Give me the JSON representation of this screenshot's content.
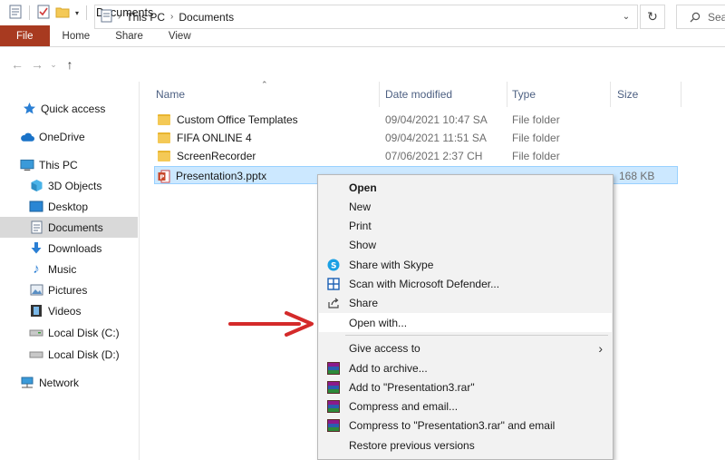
{
  "window": {
    "title": "Documents"
  },
  "ribbon": {
    "file": "File",
    "home": "Home",
    "share": "Share",
    "view": "View"
  },
  "address": {
    "crumbs": [
      "This PC",
      "Documents"
    ]
  },
  "search": {
    "placeholder": "Sea"
  },
  "nav": {
    "quick_access": "Quick access",
    "onedrive": "OneDrive",
    "this_pc": "This PC",
    "objects3d": "3D Objects",
    "desktop": "Desktop",
    "documents": "Documents",
    "downloads": "Downloads",
    "music": "Music",
    "pictures": "Pictures",
    "videos": "Videos",
    "local_c": "Local Disk (C:)",
    "local_d": "Local Disk (D:)",
    "network": "Network"
  },
  "columns": {
    "name": "Name",
    "date": "Date modified",
    "type": "Type",
    "size": "Size"
  },
  "files": [
    {
      "name": "Custom Office Templates",
      "date": "09/04/2021 10:47 SA",
      "type": "File folder",
      "size": ""
    },
    {
      "name": "FIFA ONLINE 4",
      "date": "09/04/2021 11:51 SA",
      "type": "File folder",
      "size": ""
    },
    {
      "name": "ScreenRecorder",
      "date": "07/06/2021 2:37 CH",
      "type": "File folder",
      "size": ""
    },
    {
      "name": "Presentation3.pptx",
      "date": "",
      "type": "",
      "size": "168 KB"
    }
  ],
  "context_menu": {
    "open": "Open",
    "new": "New",
    "print": "Print",
    "show": "Show",
    "skype": "Share with Skype",
    "defender": "Scan with Microsoft Defender...",
    "share": "Share",
    "open_with": "Open with...",
    "give_access": "Give access to",
    "add_archive": "Add to archive...",
    "add_rar": "Add to \"Presentation3.rar\"",
    "compress_email": "Compress and email...",
    "compress_rar_email": "Compress to \"Presentation3.rar\" and email",
    "restore": "Restore previous versions"
  },
  "colors": {
    "file_tab": "#a83a20",
    "selection": "#cce8ff",
    "arrow": "#d42a2a"
  }
}
